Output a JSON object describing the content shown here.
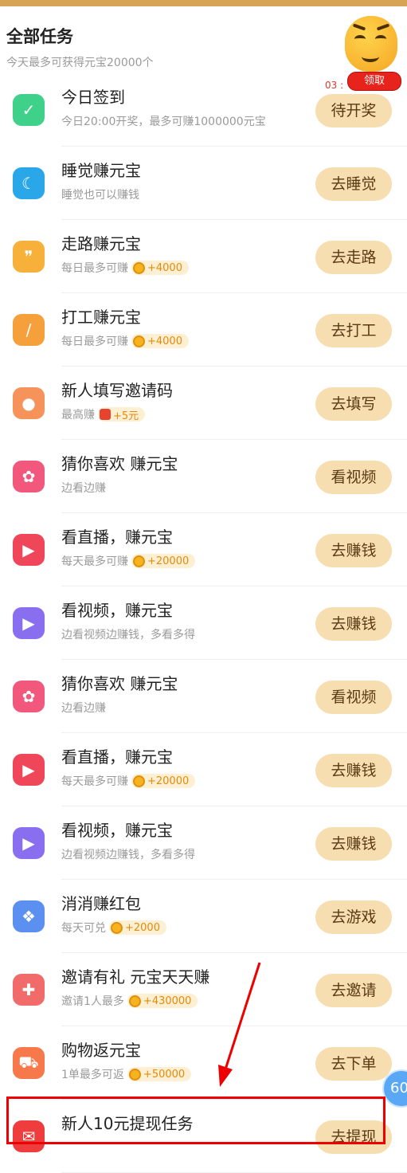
{
  "header": {
    "title": "全部任务",
    "subtitle": "今天最多可获得元宝20000个"
  },
  "floating": {
    "timer": "03 :",
    "claim_label": "领取",
    "fab_label": "60"
  },
  "tasks": [
    {
      "name": "今日签到",
      "desc": "今日20:00开奖，最多可赚1000000元宝",
      "reward": "",
      "button": "待开奖",
      "icon": "checkmark-icon",
      "color": "#3fd08a"
    },
    {
      "name": "睡觉赚元宝",
      "desc": "睡觉也可以赚钱",
      "reward": "",
      "button": "去睡觉",
      "icon": "moon-icon",
      "color": "#2aa7e8"
    },
    {
      "name": "走路赚元宝",
      "desc": "每日最多可赚",
      "reward": "+4000",
      "button": "去走路",
      "icon": "footprint-icon",
      "color": "#f7b13a"
    },
    {
      "name": "打工赚元宝",
      "desc": "每日最多可赚",
      "reward": "+4000",
      "button": "去打工",
      "icon": "brush-icon",
      "color": "#f6a03b"
    },
    {
      "name": "新人填写邀请码",
      "desc": "最高赚",
      "reward": "+5元",
      "button": "去填写",
      "icon": "person-icon",
      "color": "#f6935b"
    },
    {
      "name": "猜你喜欢 赚元宝",
      "desc": "边看边赚",
      "reward": "",
      "button": "看视频",
      "icon": "gift-box-icon",
      "color": "#f2587c"
    },
    {
      "name": "看直播，赚元宝",
      "desc": "每天最多可赚",
      "reward": "+20000",
      "button": "去赚钱",
      "icon": "play-icon",
      "color": "#f0465a"
    },
    {
      "name": "看视频，赚元宝",
      "desc": "边看视频边赚钱，多看多得",
      "reward": "",
      "button": "去赚钱",
      "icon": "play-icon",
      "color": "#8a6ef0"
    },
    {
      "name": "猜你喜欢 赚元宝",
      "desc": "边看边赚",
      "reward": "",
      "button": "看视频",
      "icon": "gift-box-icon",
      "color": "#f2587c"
    },
    {
      "name": "看直播，赚元宝",
      "desc": "每天最多可赚",
      "reward": "+20000",
      "button": "去赚钱",
      "icon": "play-icon",
      "color": "#f0465a"
    },
    {
      "name": "看视频，赚元宝",
      "desc": "边看视频边赚钱，多看多得",
      "reward": "",
      "button": "去赚钱",
      "icon": "play-icon",
      "color": "#8a6ef0"
    },
    {
      "name": "消消赚红包",
      "desc": "每天可兑",
      "reward": "+2000",
      "button": "去游戏",
      "icon": "game-blocks-icon",
      "color": "#5b8ff0"
    },
    {
      "name": "邀请有礼 元宝天天赚",
      "desc": "邀请1人最多",
      "reward": "+430000",
      "button": "去邀请",
      "icon": "invite-person-icon",
      "color": "#f26b6b"
    },
    {
      "name": "购物返元宝",
      "desc": "1单最多可返",
      "reward": "+50000",
      "button": "去下单",
      "icon": "cart-icon",
      "color": "#f7784a"
    },
    {
      "name": "新人10元提现任务",
      "desc": "",
      "reward": "",
      "button": "去提现",
      "icon": "red-envelope-icon",
      "color": "#ef3d3d"
    }
  ]
}
